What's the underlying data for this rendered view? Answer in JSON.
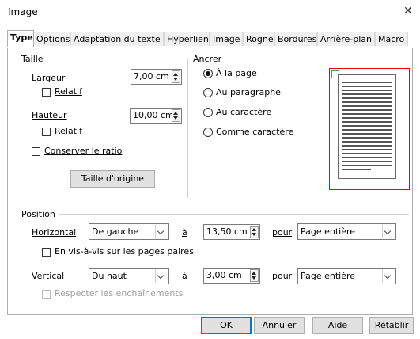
{
  "window": {
    "title": "Image",
    "close_symbol": "✕"
  },
  "tabs": [
    {
      "label": "Type",
      "active": true
    },
    {
      "label": "Options"
    },
    {
      "label": "Adaptation du texte"
    },
    {
      "label": "Hyperlien"
    },
    {
      "label": "Image"
    },
    {
      "label": "Rogner"
    },
    {
      "label": "Bordures"
    },
    {
      "label": "Arrière-plan"
    },
    {
      "label": "Macro"
    }
  ],
  "size": {
    "section_label": "Taille",
    "width_label": "Largeur",
    "width_value": "7,00 cm",
    "width_relative_label": "Relatif",
    "height_label": "Hauteur",
    "height_value": "10,00 cm",
    "height_relative_label": "Relatif",
    "keep_ratio_label": "Conserver le ratio",
    "original_size_button": "Taille d'origine"
  },
  "anchor": {
    "section_label": "Ancrer",
    "options": [
      {
        "label": "À la page",
        "selected": true
      },
      {
        "label": "Au paragraphe"
      },
      {
        "label": "Au caractère"
      },
      {
        "label": "Comme caractère"
      }
    ]
  },
  "position": {
    "section_label": "Position",
    "horizontal_label": "Horizontal",
    "horizontal_select": "De gauche",
    "horizontal_at_label": "à",
    "horizontal_value": "13,50 cm",
    "horizontal_for_label": "pour",
    "horizontal_for_select": "Page entière",
    "mirror_label": "En vis-à-vis sur les pages paires",
    "vertical_label": "Vertical",
    "vertical_select": "Du haut",
    "vertical_at_label": "à",
    "vertical_value": "3,00 cm",
    "vertical_for_label": "pour",
    "vertical_for_select": "Page entière",
    "follow_flow_label": "Respecter les enchaînements"
  },
  "buttons": {
    "ok": "OK",
    "cancel": "Annuler",
    "help": "Aide",
    "reset": "Rétablir"
  },
  "colors": {
    "accent": "#0078d7",
    "preview_border": "#e00000",
    "anchor_marker": "#2fb52f"
  }
}
